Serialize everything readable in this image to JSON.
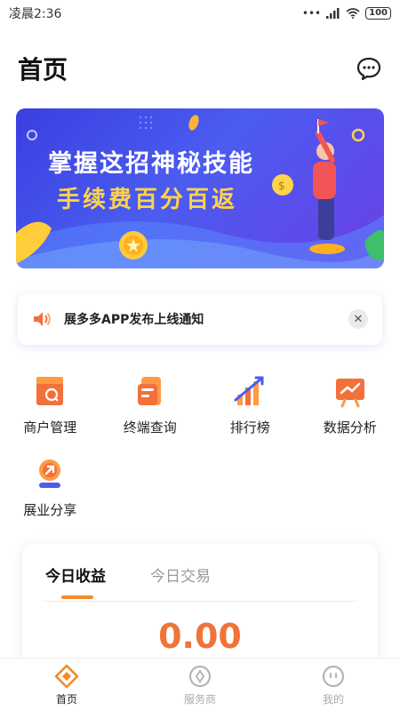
{
  "status_bar": {
    "time": "凌晨2:36",
    "battery": "100"
  },
  "header": {
    "title": "首页",
    "message_icon": "chat-bubble-icon"
  },
  "banner": {
    "line1": "掌握这招神秘技能",
    "line2": "手续费百分百返"
  },
  "notice": {
    "text": "展多多APP发布上线通知",
    "close_label": "✕"
  },
  "grid": {
    "items": [
      {
        "label": "商户管理",
        "icon": "shop-icon"
      },
      {
        "label": "终端查询",
        "icon": "terminal-icon"
      },
      {
        "label": "排行榜",
        "icon": "ranking-chart-icon"
      },
      {
        "label": "数据分析",
        "icon": "analytics-board-icon"
      },
      {
        "label": "展业分享",
        "icon": "share-icon"
      }
    ]
  },
  "earnings": {
    "tabs": [
      {
        "label": "今日收益"
      },
      {
        "label": "今日交易"
      }
    ],
    "amount": "0.00"
  },
  "bottom_nav": {
    "items": [
      {
        "label": "首页"
      },
      {
        "label": "服务商"
      },
      {
        "label": "我的"
      }
    ]
  },
  "colors": {
    "accent": "#f28b2b",
    "amount": "#f0743a",
    "banner_blue": "#4b5cf0",
    "banner_yellow": "#ffd34a"
  }
}
